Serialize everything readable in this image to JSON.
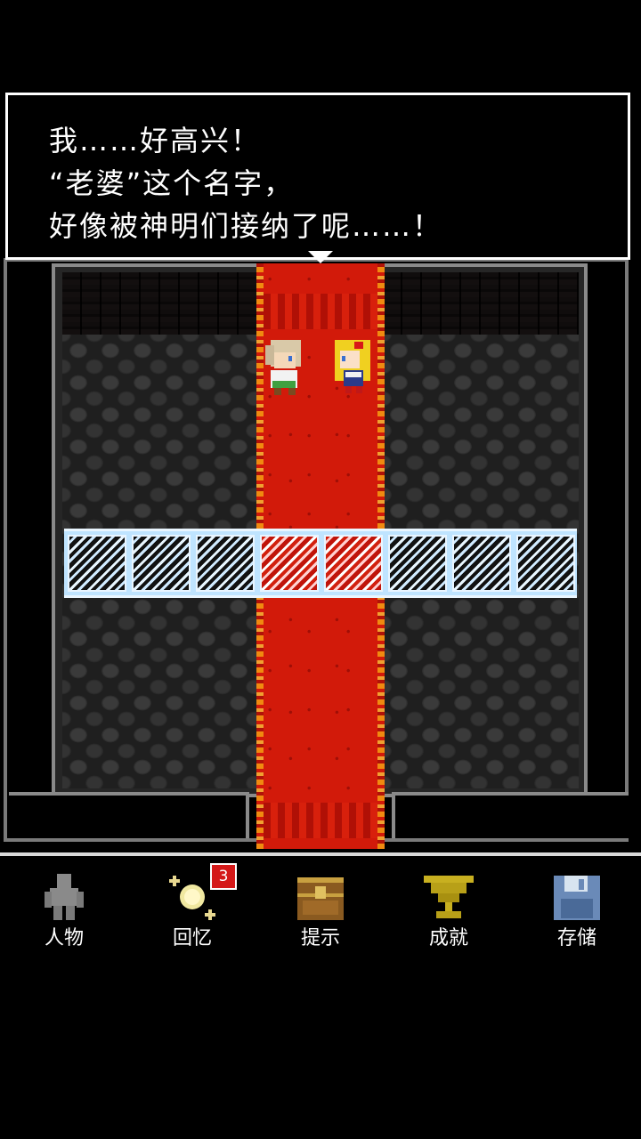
{
  "dialog": {
    "line1": "我……好高兴！",
    "line2": "“老婆”这个名字，",
    "line3": "好像被神明们接纳了呢……！"
  },
  "menu": {
    "items": [
      {
        "label": "人物",
        "icon": "person-icon"
      },
      {
        "label": "回忆",
        "icon": "sparkle-orb-icon"
      },
      {
        "label": "提示",
        "icon": "treasure-chest-icon"
      },
      {
        "label": "成就",
        "icon": "trophy-icon"
      },
      {
        "label": "存储",
        "icon": "floppy-disk-icon"
      }
    ],
    "memory_badge": "3"
  },
  "colors": {
    "carpet": "#d21a0a",
    "ice": "#bfe4ff",
    "badge": "#d41818",
    "trophy": "#c8b020"
  }
}
